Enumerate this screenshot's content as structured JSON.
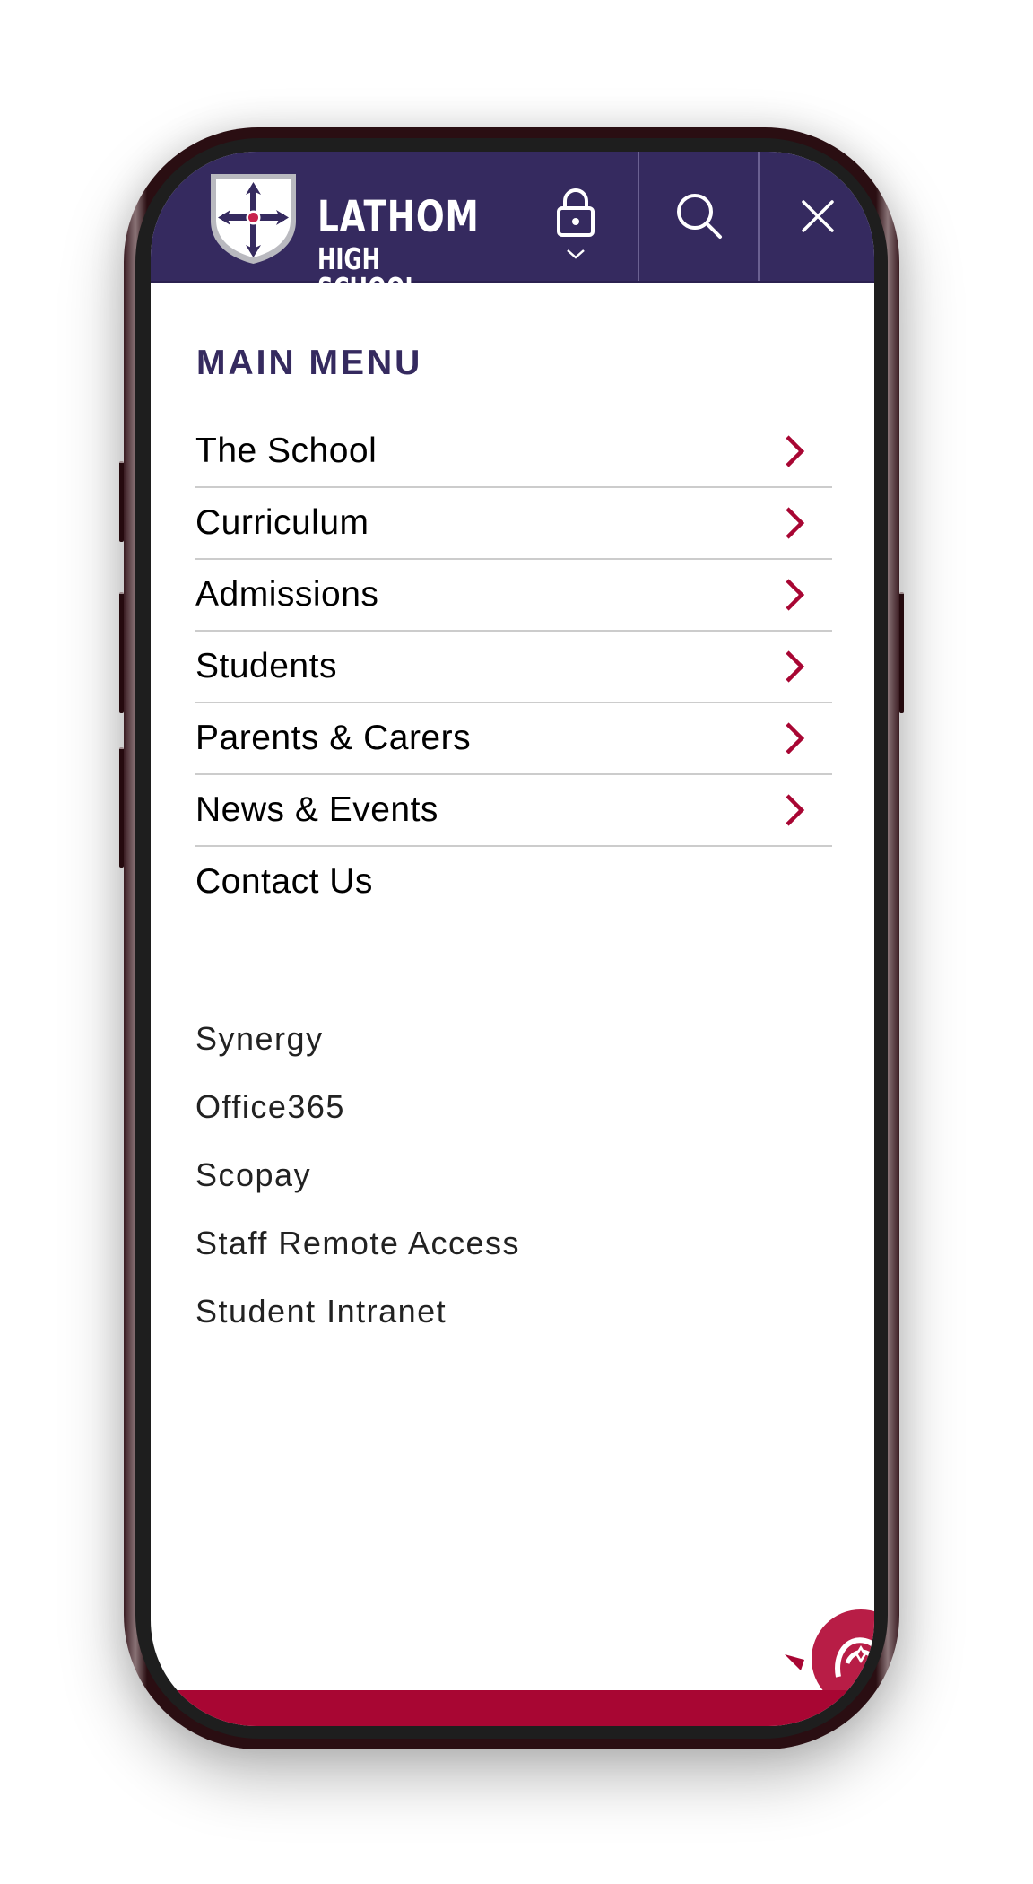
{
  "header": {
    "logo_line1": "LATHOM",
    "logo_line2": "HIGH SCHOOL",
    "icons": {
      "lock": "lock-icon",
      "lock_dropdown": "chevron-down-icon",
      "search": "search-icon",
      "close": "close-icon"
    }
  },
  "menu": {
    "title": "MAIN MENU",
    "items": [
      {
        "label": "The School",
        "has_submenu": true
      },
      {
        "label": "Curriculum",
        "has_submenu": true
      },
      {
        "label": "Admissions",
        "has_submenu": true
      },
      {
        "label": "Students",
        "has_submenu": true
      },
      {
        "label": "Parents & Carers",
        "has_submenu": true
      },
      {
        "label": "News & Events",
        "has_submenu": true
      },
      {
        "label": "Contact Us",
        "has_submenu": false
      }
    ]
  },
  "quick_links": [
    {
      "label": "Synergy"
    },
    {
      "label": "Office365"
    },
    {
      "label": "Scopay"
    },
    {
      "label": "Staff Remote Access"
    },
    {
      "label": "Student Intranet"
    }
  ],
  "colors": {
    "brand_purple": "#352a5f",
    "accent_red": "#a80633",
    "chevron": "#a80633",
    "divider": "#cccccc"
  }
}
